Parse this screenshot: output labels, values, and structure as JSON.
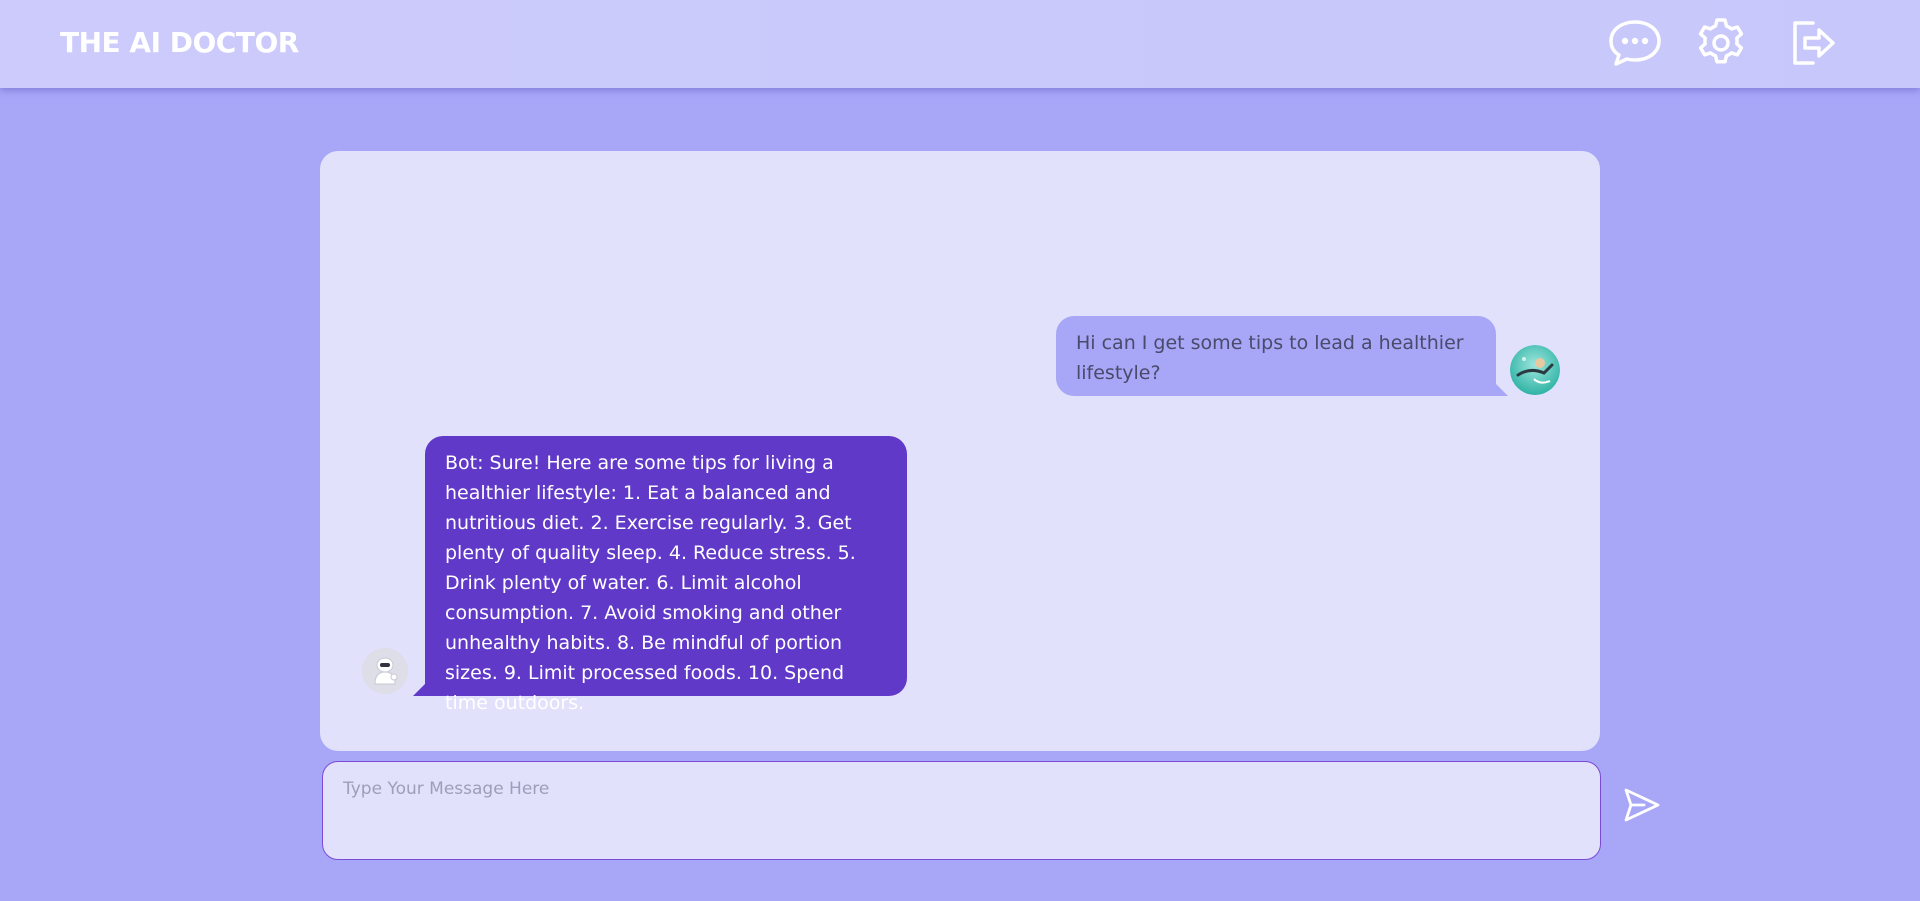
{
  "app": {
    "title": "THE AI DOCTOR"
  },
  "header": {
    "icons": [
      "chat-icon",
      "settings-gear-icon",
      "logout-icon"
    ]
  },
  "messages": {
    "user": {
      "text": "Hi can I get some tips to lead a healthier lifestyle?"
    },
    "bot": {
      "text": "Bot: Sure! Here are some tips for living a healthier lifestyle: 1. Eat a balanced and nutritious diet. 2. Exercise regularly. 3. Get plenty of quality sleep. 4. Reduce stress. 5. Drink plenty of water. 6. Limit alcohol consumption. 7. Avoid smoking and other unhealthy habits. 8. Be mindful of portion sizes. 9. Limit processed foods. 10. Spend time outdoors."
    }
  },
  "composer": {
    "placeholder": "Type Your Message Here",
    "value": ""
  },
  "colors": {
    "background": "#a7a6f7",
    "header": "#c9c8fb",
    "panel": "#e1e1fc",
    "user_bubble": "#a7a6f7",
    "bot_bubble": "#6139c9",
    "input_border": "#7b4bd8"
  }
}
